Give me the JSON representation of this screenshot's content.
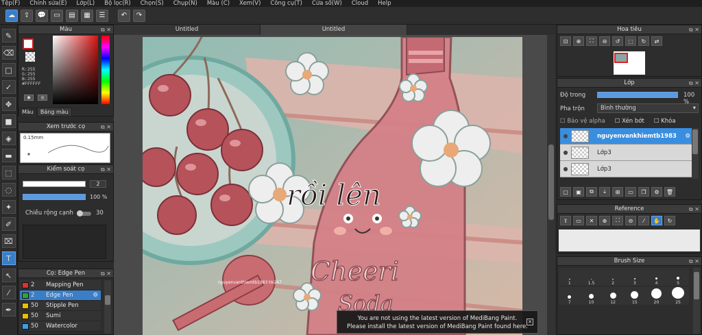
{
  "menu": [
    "Tệp(F)",
    "Chỉnh sửa(E)",
    "Lớp(L)",
    "Bộ lọc(R)",
    "Chọn(S)",
    "Chụp(N)",
    "Màu (C)",
    "Xem(V)",
    "Công cụ(T)",
    "Cửa sổ(W)",
    "Cloud",
    "Help"
  ],
  "toolbar": {
    "icons": [
      "cloud-icon",
      "share-icon",
      "comment-icon",
      "chat-icon",
      "page-icon",
      "grid-icon",
      "list-icon"
    ],
    "undo_icon": "undo-icon",
    "redo_icon": "redo-icon"
  },
  "tools": [
    "brush-icon",
    "eraser-icon",
    "rectangle-icon",
    "check-icon",
    "move-icon",
    "fill-rect-icon",
    "bucket-icon",
    "gradient-icon",
    "select-rect-icon",
    "lasso-icon",
    "magic-wand-icon",
    "pen-select-icon",
    "select-eraser-icon",
    "text-icon",
    "operation-icon",
    "eyedropper-icon",
    "pen-icon",
    "hand-icon"
  ],
  "color_panel": {
    "title": "Màu",
    "r": "R:255",
    "g": "G:255",
    "b": "B:255",
    "hex": "#FFFFFF",
    "tab_color": "Màu",
    "tab_palette": "Bảng màu",
    "fg_color": "#ffffff",
    "accent": "#d21c1c"
  },
  "brush_preview": {
    "title": "Xem trước cọ",
    "size_label": "0.15mm"
  },
  "brush_control": {
    "title": "Kiểm soát cọ",
    "size_value": "2",
    "opacity_value": "100 %",
    "opacity_level": 100,
    "width_label": "Chiều rộng cạnh",
    "width_value": "30"
  },
  "brush_list": {
    "title": "Cọ: Edge Pen",
    "items": [
      {
        "size": "2",
        "name": "Mapping Pen",
        "color": "#e03030"
      },
      {
        "size": "2",
        "name": "Edge Pen",
        "color": "#2ea82e"
      },
      {
        "size": "50",
        "name": "Stipple Pen",
        "color": "#e8c000"
      },
      {
        "size": "50",
        "name": "Sumi",
        "color": "#e8c000"
      },
      {
        "size": "50",
        "name": "Watercolor",
        "color": "#3aa0e8"
      }
    ]
  },
  "document_tabs": [
    "Untitled",
    "Untitled"
  ],
  "artwork": {
    "overlay_text": "rồi lên",
    "bottle_text_1": "Cheeri",
    "bottle_text_2": "Soda",
    "signature": "nguyenvanthiemtb1983\nhk247"
  },
  "notice": {
    "line1": "You are not using the latest version of MediBang Paint.",
    "line2": "Please install the latest version of MediBang Paint found here."
  },
  "navigator": {
    "title": "Hoa tiêu"
  },
  "layer_panel": {
    "title": "Lớp",
    "opacity_label": "Độ trong",
    "opacity_value": "100 %",
    "opacity_level": 100,
    "blend_label": "Pha trộn",
    "blend_value": "Bình thường",
    "protect_alpha": "Bảo vệ alpha",
    "clipping": "Xén bớt",
    "lock": "Khóa",
    "layers": [
      "nguyenvankhiemtb1983",
      "Lớp3",
      "Lớp3"
    ]
  },
  "reference": {
    "title": "Reference"
  },
  "brush_size": {
    "title": "Brush Size",
    "sizes": [
      "1",
      "1.5",
      "2",
      "3",
      "4",
      "5",
      "7",
      "10",
      "12",
      "15",
      "20",
      "25"
    ]
  }
}
